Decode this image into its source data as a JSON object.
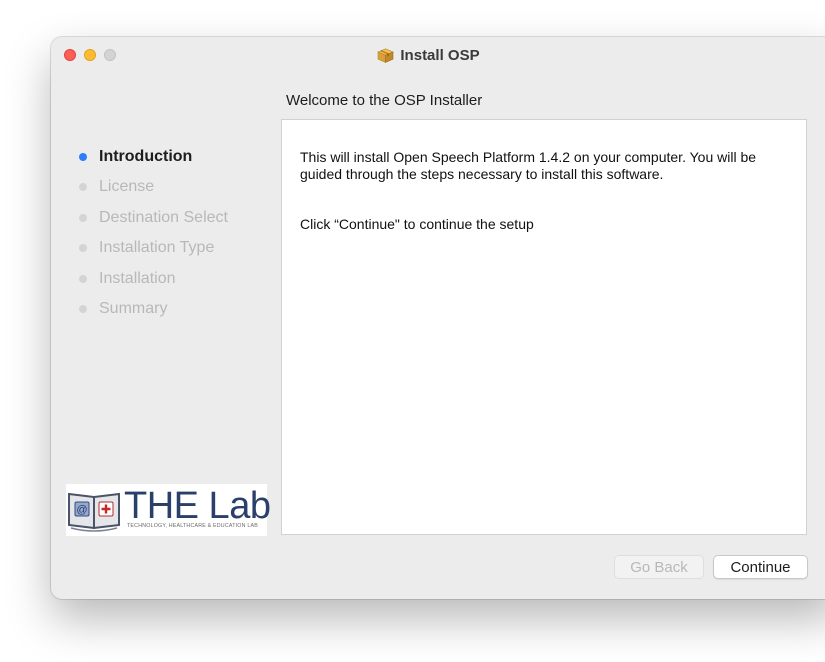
{
  "window": {
    "title": "Install OSP",
    "title_icon": "package-icon"
  },
  "header": {
    "subtitle": "Welcome to the OSP Installer"
  },
  "sidebar": {
    "steps": [
      {
        "label": "Introduction",
        "active": true
      },
      {
        "label": "License",
        "active": false
      },
      {
        "label": "Destination Select",
        "active": false
      },
      {
        "label": "Installation Type",
        "active": false
      },
      {
        "label": "Installation",
        "active": false
      },
      {
        "label": "Summary",
        "active": false
      }
    ],
    "logo": {
      "title": "THE Lab",
      "subtitle": "TECHNOLOGY, HEALTHCARE & EDUCATION LAB"
    }
  },
  "content": {
    "paragraph1": "This will install Open Speech Platform 1.4.2 on your computer. You will be guided through the steps necessary to install this software.",
    "paragraph2": "Click “Continue\" to continue the setup"
  },
  "buttons": {
    "back_label": "Go Back",
    "continue_label": "Continue"
  },
  "colors": {
    "active_step_dot": "#2d7ff9",
    "close": "#fe5f57",
    "minimize": "#febc2e",
    "zoom_disabled": "#d3d3d3"
  }
}
